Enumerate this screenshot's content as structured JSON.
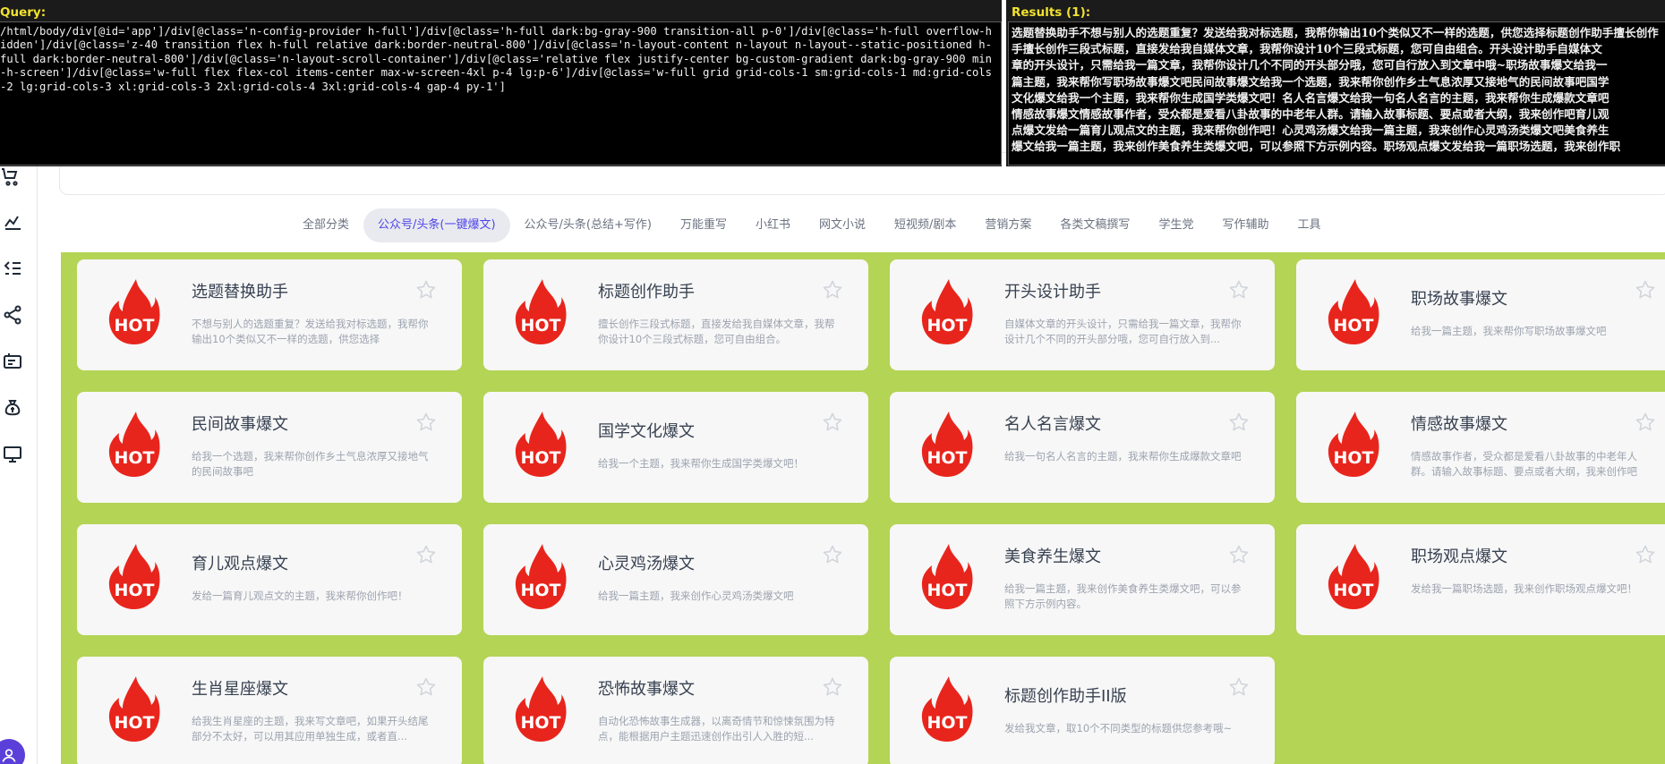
{
  "overlay": {
    "query_label": "Query:",
    "query_text": "/html/body/div[@id='app']/div[@class='n-config-provider h-full']/div[@class='h-full dark:bg-gray-900 transition-all p-0']/div[@class='h-full overflow-hidden']/div[@class='z-40 transition flex h-full relative dark:border-neutral-800']/div[@class='n-layout-content n-layout n-layout--static-positioned h-full dark:border-neutral-800']/div[@class='n-layout-scroll-container']/div[@class='relative flex justify-center bg-custom-gradient dark:bg-gray-900 min-h-screen']/div[@class='w-full flex flex-col items-center max-w-screen-4xl p-4 lg:p-6']/div[@class='w-full grid grid-cols-1 sm:grid-cols-1 md:grid-cols-2 lg:grid-cols-3 xl:grid-cols-3 2xl:grid-cols-4 3xl:grid-cols-4 gap-4 py-1']",
    "results_label": "Results (1):",
    "results_lines": [
      "选题替换助手不想与别人的选题重复？发送给我对标选题，我帮你输出10个类似又不一样的选题，供您选择标题创作助手擅长创作",
      "手擅长创作三段式标题，直接发给我自媒体文章，我帮你设计10个三段式标题，您可自由组合。开头设计助手自媒体文",
      "章的开头设计，只需给我一篇文章，我帮你设计几个不同的开头部分哦，您可自行放入到文章中哦~职场故事爆文给我一",
      "篇主题，我来帮你写职场故事爆文吧民间故事爆文给我一个选题，我来帮你创作乡土气息浓厚又接地气的民间故事吧国学",
      "文化爆文给我一个主题，我来帮你生成国学类爆文吧！名人名言爆文给我一句名人名言的主题，我来帮你生成爆款文章吧",
      "情感故事爆文情感故事作者，受众都是爱看八卦故事的中老年人群。请输入故事标题、要点或者大纲，我来创作吧育儿观",
      "点爆文发给一篇育儿观点文的主题，我来帮你创作吧！心灵鸡汤爆文给我一篇主题，我来创作心灵鸡汤类爆文吧美食养生",
      "爆文给我一篇主题，我来创作美食养生类爆文吧，可以参照下方示例内容。职场观点爆文发给我一篇职场选题，我来创作职"
    ]
  },
  "tabs": [
    {
      "label": "全部分类",
      "active": false
    },
    {
      "label": "公众号/头条(一键爆文)",
      "active": true
    },
    {
      "label": "公众号/头条(总结+写作)",
      "active": false
    },
    {
      "label": "万能重写",
      "active": false
    },
    {
      "label": "小红书",
      "active": false
    },
    {
      "label": "网文小说",
      "active": false
    },
    {
      "label": "短视频/剧本",
      "active": false
    },
    {
      "label": "营销方案",
      "active": false
    },
    {
      "label": "各类文稿撰写",
      "active": false
    },
    {
      "label": "学生党",
      "active": false
    },
    {
      "label": "写作辅助",
      "active": false
    },
    {
      "label": "工具",
      "active": false
    }
  ],
  "cards": [
    {
      "title": "选题替换助手",
      "desc": "不想与别人的选题重复？发送给我对标选题，我帮你输出10个类似又不一样的选题，供您选择",
      "single": false
    },
    {
      "title": "标题创作助手",
      "desc": "擅长创作三段式标题，直接发给我自媒体文章，我帮你设计10个三段式标题，您可自由组合。",
      "single": false
    },
    {
      "title": "开头设计助手",
      "desc": "自媒体文章的开头设计，只需给我一篇文章，我帮你设计几个不同的开头部分哦，您可自行放入到...",
      "single": false
    },
    {
      "title": "职场故事爆文",
      "desc": "给我一篇主题，我来帮你写职场故事爆文吧",
      "single": true
    },
    {
      "title": "民间故事爆文",
      "desc": "给我一个选题，我来帮你创作乡土气息浓厚又接地气的民间故事吧",
      "single": false
    },
    {
      "title": "国学文化爆文",
      "desc": "给我一个主题，我来帮你生成国学类爆文吧！",
      "single": true
    },
    {
      "title": "名人名言爆文",
      "desc": "给我一句名人名言的主题，我来帮你生成爆款文章吧",
      "single": false
    },
    {
      "title": "情感故事爆文",
      "desc": "情感故事作者，受众都是爱看八卦故事的中老年人群。请输入故事标题、要点或者大纲，我来创作吧",
      "single": false
    },
    {
      "title": "育儿观点爆文",
      "desc": "发给一篇育儿观点文的主题，我来帮你创作吧！",
      "single": true
    },
    {
      "title": "心灵鸡汤爆文",
      "desc": "给我一篇主题，我来创作心灵鸡汤类爆文吧",
      "single": true
    },
    {
      "title": "美食养生爆文",
      "desc": "给我一篇主题，我来创作美食养生类爆文吧，可以参照下方示例内容。",
      "single": false
    },
    {
      "title": "职场观点爆文",
      "desc": "发给我一篇职场选题，我来创作职场观点爆文吧！",
      "single": false
    },
    {
      "title": "生肖星座爆文",
      "desc": "给我生肖星座的主题，我来写文章吧，如果开头结尾部分不太好，可以用其应用单独生成，或者直...",
      "single": false
    },
    {
      "title": "恐怖故事爆文",
      "desc": "自动化恐怖故事生成器，以离奇情节和惊悚氛围为特点，能根据用户主题迅速创作出引人入胜的短...",
      "single": false
    },
    {
      "title": "标题创作助手II版",
      "desc": "发给我文章，取10个不同类型的标题供您参考哦~",
      "single": true
    }
  ],
  "hot_badge_text": "HOT",
  "colors": {
    "accent": "#4f46e5",
    "grid_bg": "#b4d455",
    "hot_red": "#e8251c"
  }
}
